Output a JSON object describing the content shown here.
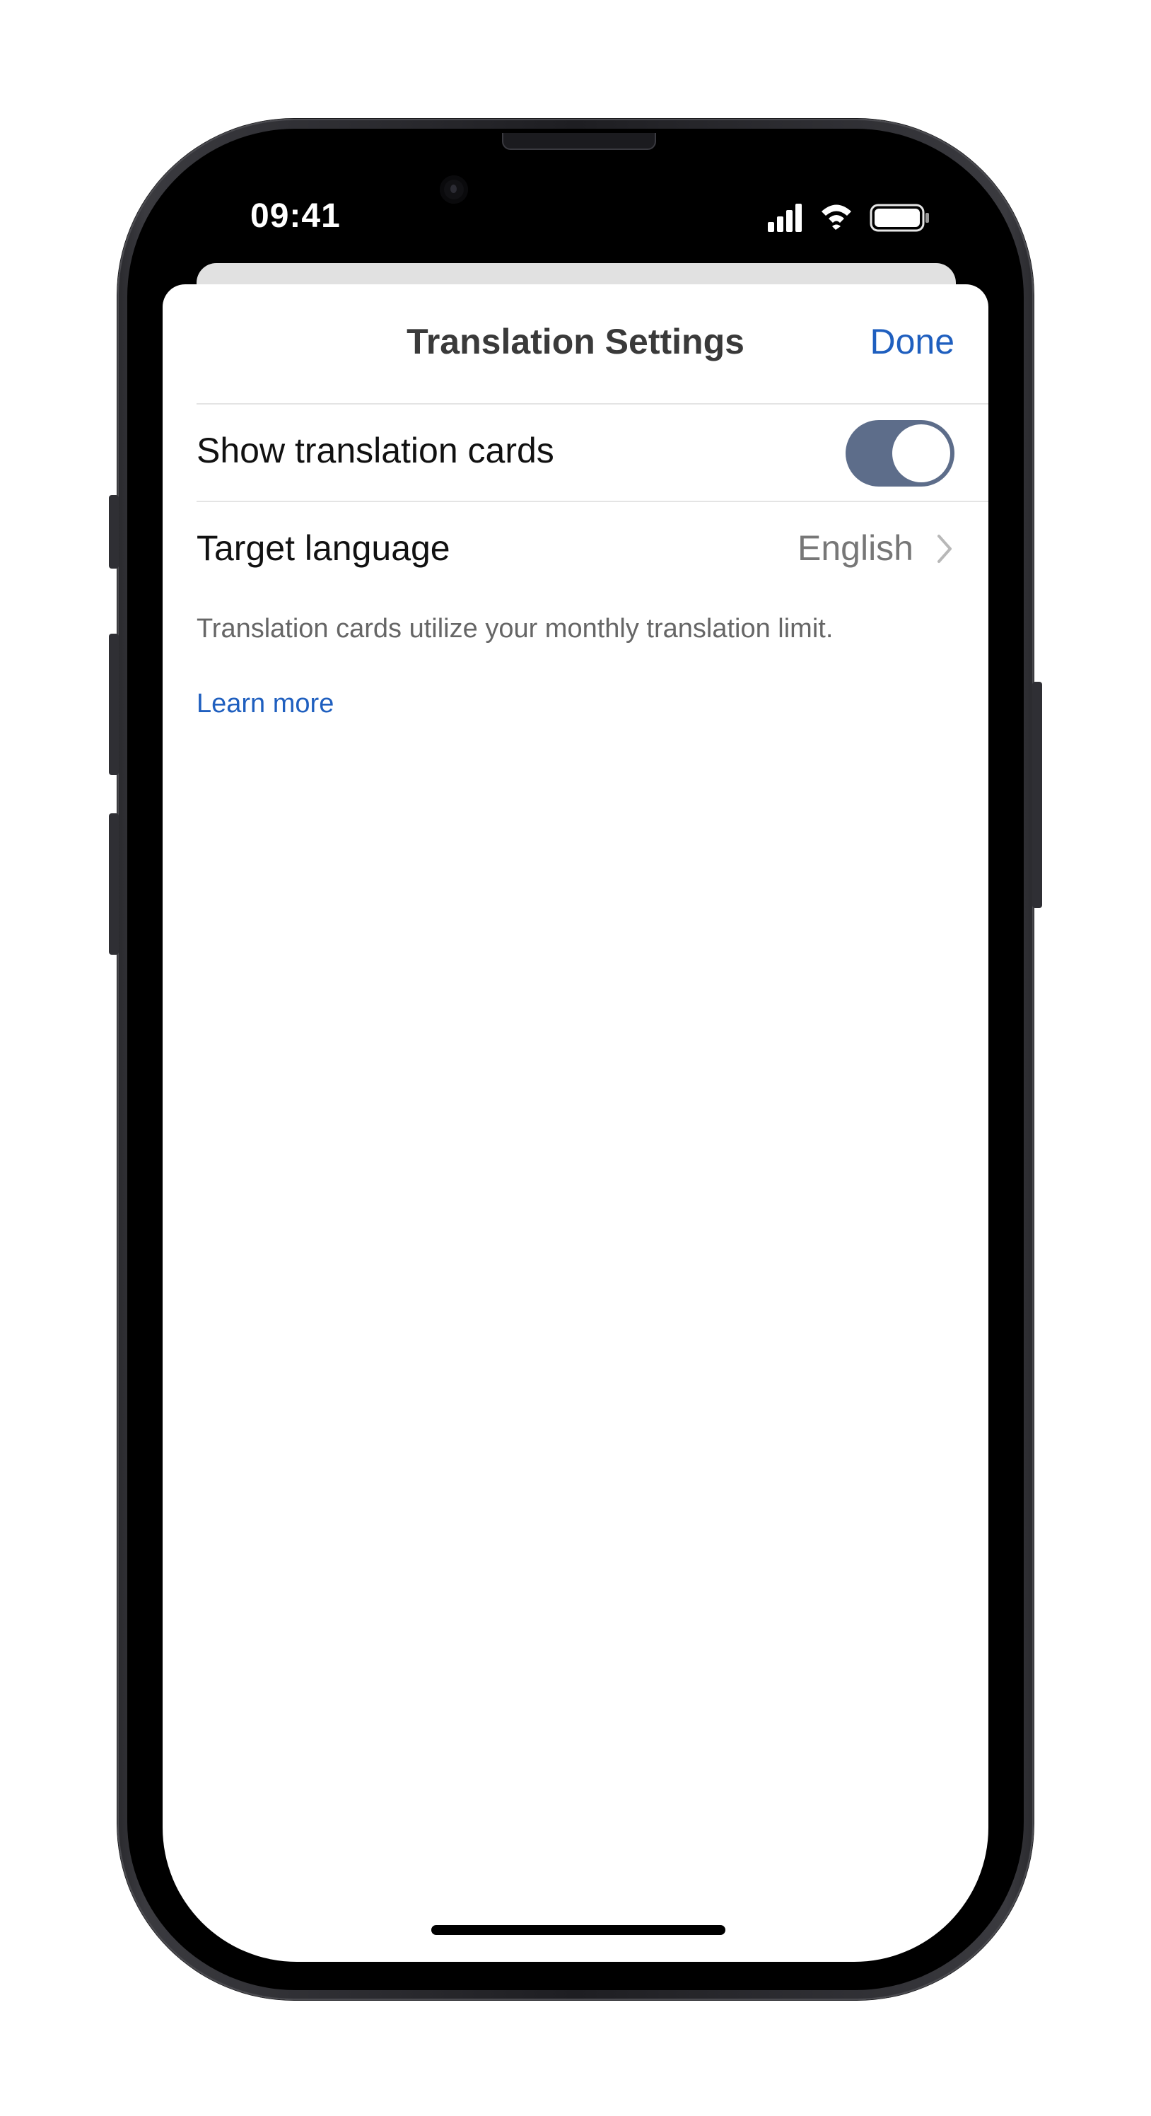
{
  "status_bar": {
    "time": "09:41"
  },
  "sheet": {
    "title": "Translation Settings",
    "done_label": "Done"
  },
  "settings": {
    "show_cards": {
      "label": "Show translation cards",
      "enabled": true
    },
    "target_language": {
      "label": "Target language",
      "value": "English"
    }
  },
  "footnote": "Translation cards utilize your monthly translation limit.",
  "learn_more_label": "Learn more",
  "icons": {
    "signal": "cellular-signal-icon",
    "wifi": "wifi-icon",
    "battery": "battery-icon",
    "chevron": "chevron-right-icon"
  },
  "colors": {
    "accent": "#1f5fbf",
    "toggle_on": "#5d6d8a",
    "title_text": "#3a3a3a",
    "secondary_text": "#777777"
  }
}
